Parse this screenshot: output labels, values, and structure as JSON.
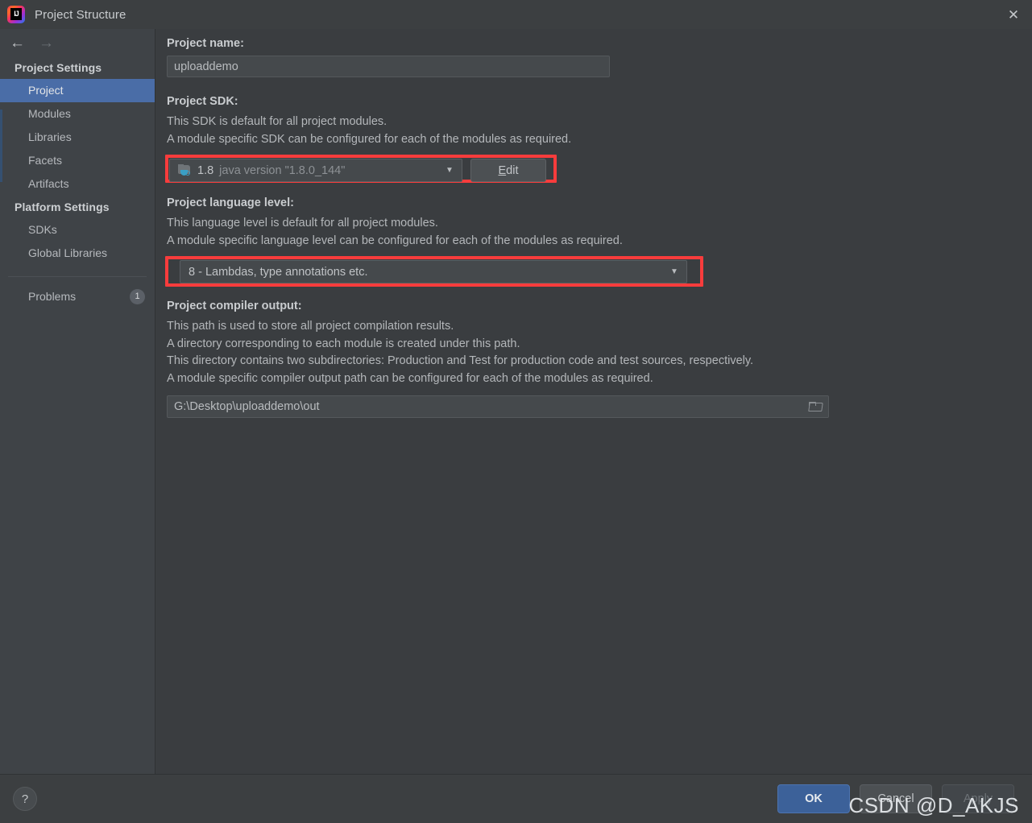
{
  "window": {
    "title": "Project Structure",
    "logo_icon": "intellij-idea-logo",
    "close_icon": "close-icon"
  },
  "nav": {
    "back_icon": "arrow-left-icon",
    "forward_icon": "arrow-right-icon"
  },
  "sidebar": {
    "groups": [
      {
        "title": "Project Settings",
        "items": [
          {
            "label": "Project",
            "selected": true
          },
          {
            "label": "Modules",
            "selected": false
          },
          {
            "label": "Libraries",
            "selected": false
          },
          {
            "label": "Facets",
            "selected": false
          },
          {
            "label": "Artifacts",
            "selected": false
          }
        ]
      },
      {
        "title": "Platform Settings",
        "items": [
          {
            "label": "SDKs",
            "selected": false
          },
          {
            "label": "Global Libraries",
            "selected": false
          }
        ]
      }
    ],
    "problems": {
      "label": "Problems",
      "badge": "1"
    }
  },
  "main": {
    "project_name": {
      "label": "Project name:",
      "value": "uploaddemo"
    },
    "project_sdk": {
      "label": "Project SDK:",
      "description": [
        "This SDK is default for all project modules.",
        "A module specific SDK can be configured for each of the modules as required."
      ],
      "icon": "java-sdk-icon",
      "value_name": "1.8",
      "value_detail": "java version \"1.8.0_144\"",
      "dropdown_icon": "chevron-down-icon",
      "edit_button": {
        "label": "Edit",
        "mnemonic": "E",
        "rest": "dit"
      },
      "highlighted": true
    },
    "language_level": {
      "label": "Project language level:",
      "description": [
        "This language level is default for all project modules.",
        "A module specific language level can be configured for each of the modules as required."
      ],
      "value": "8 - Lambdas, type annotations etc.",
      "dropdown_icon": "chevron-down-icon",
      "highlighted": true
    },
    "compiler_output": {
      "label": "Project compiler output:",
      "description": [
        "This path is used to store all project compilation results.",
        "A directory corresponding to each module is created under this path.",
        "This directory contains two subdirectories: Production and Test for production code and test sources, respectively.",
        "A module specific compiler output path can be configured for each of the modules as required."
      ],
      "value": "G:\\Desktop\\uploaddemo\\out",
      "browse_icon": "folder-browse-icon"
    }
  },
  "footer": {
    "help_label": "?",
    "buttons": [
      {
        "label": "OK",
        "style": "primary"
      },
      {
        "label": "Cancel",
        "style": "normal"
      },
      {
        "label": "Apply",
        "style": "disabled"
      }
    ]
  },
  "watermark": {
    "text": "CSDN @D_AKJS"
  },
  "colors": {
    "accent_selection": "#4a6da7",
    "primary_button": "#3c6199",
    "annotation_red": "#f83c3c",
    "sidebar_bg": "#3f4347",
    "content_bg": "#3a3d40",
    "window_bg": "#3c3f41"
  }
}
